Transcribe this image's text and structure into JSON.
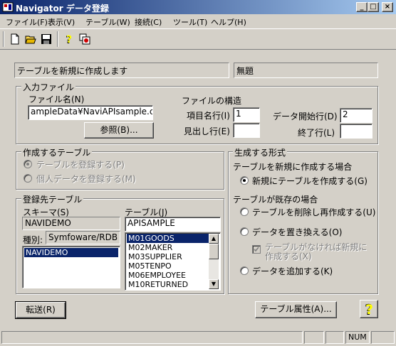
{
  "window": {
    "title": "Navigator データ登録",
    "min_glyph": "_",
    "max_glyph": "□",
    "close_glyph": "×"
  },
  "menu": [
    "ファイル(F)",
    "表示(V)",
    "テーブル(W)",
    "接続(C)",
    "ツール(T)",
    "ヘルプ(H)"
  ],
  "toolbar": {
    "icons": [
      "new-file-icon",
      "open-folder-icon",
      "save-icon",
      "help-icon",
      "copy-window-icon"
    ]
  },
  "status_message": "テーブルを新規に作成します",
  "status_title": "無題",
  "input_file": {
    "group_label": "入力ファイル",
    "file_name_label": "ファイル名(N)",
    "file_name_value": "ampleData¥NaviAPIsample.csv",
    "browse_button": "参照(B)...",
    "structure_label": "ファイルの構造",
    "item_row_label": "項目名行(I)",
    "item_row_value": "1",
    "heading_row_label": "見出し行(E)",
    "heading_row_value": "",
    "data_start_label": "データ開始行(D)",
    "data_start_value": "2",
    "end_row_label": "終了行(L)",
    "end_row_value": ""
  },
  "create_table": {
    "group_label": "作成するテーブル",
    "option_table": "テーブルを登録する(P)",
    "option_personal": "個人データを登録する(M)"
  },
  "destination": {
    "group_label": "登録先テーブル",
    "schema_label": "スキーマ(S)",
    "schema_value": "NAVIDEMO",
    "kind_label": "種別:",
    "kind_value": "Symfoware/RDB",
    "schema_list": [
      "NAVIDEMO"
    ],
    "table_label": "テーブル(J)",
    "table_value": "APISAMPLE",
    "table_list": [
      "M01GOODS",
      "M02MAKER",
      "M03SUPPLIER",
      "M05TENPO",
      "M06EMPLOYEE",
      "M10RETURNED"
    ],
    "scroll_up_glyph": "▲",
    "scroll_down_glyph": "▼"
  },
  "generation": {
    "group_label": "生成する形式",
    "new_case_label": "テーブルを新規に作成する場合",
    "new_option": "新規にテーブルを作成する(G)",
    "exist_case_label": "テーブルが既存の場合",
    "opt_recreate": "テーブルを削除し再作成する(U)",
    "opt_replace": "データを置き換える(O)",
    "opt_create_if_missing_line1": "テーブルがなければ新規に",
    "opt_create_if_missing_line2": "作成する(X)",
    "opt_append": "データを追加する(K)"
  },
  "buttons": {
    "transfer": "転送(R)",
    "table_attr": "テーブル属性(A)...",
    "help_glyph": "?"
  },
  "statusbar": {
    "num": "NUM"
  }
}
